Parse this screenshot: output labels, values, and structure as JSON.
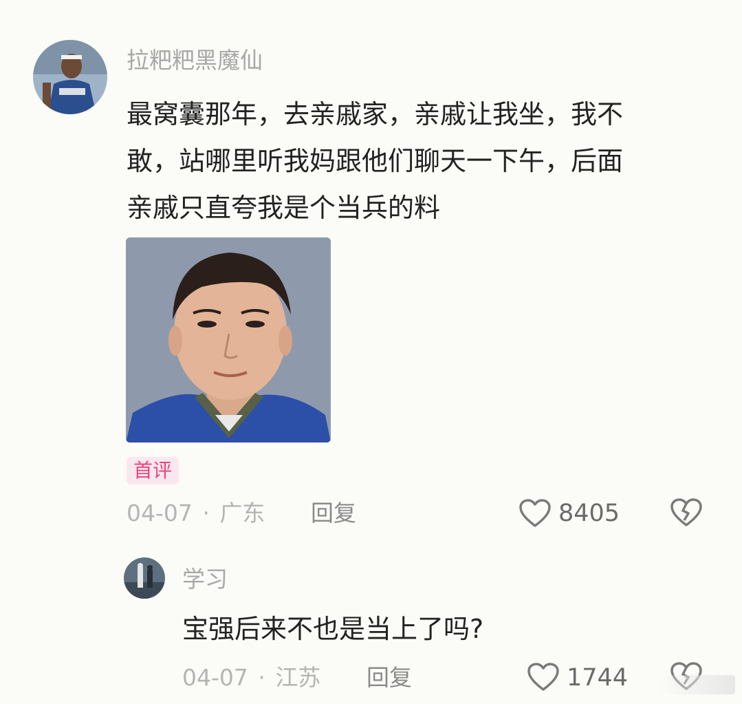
{
  "comment": {
    "username": "拉粑粑黑魔仙",
    "text_lines": [
      "最窝囊那年，去亲戚家，亲戚让我坐，我不",
      "敢，站哪里听我妈跟他们聊天一下午，后面",
      "亲戚只直夸我是个当兵的料"
    ],
    "badge": "首评",
    "date": "04-07",
    "separator": "·",
    "location": "广东",
    "reply_label": "回复",
    "like_count": "8405",
    "like_icon": "heart-outline-icon",
    "dislike_icon": "broken-heart-icon"
  },
  "reply": {
    "username": "学习",
    "text": "宝强后来不也是当上了吗?",
    "date": "04-07",
    "separator": "·",
    "location": "江苏",
    "reply_label": "回复",
    "like_count": "1744",
    "like_icon": "heart-outline-icon",
    "dislike_icon": "broken-heart-icon"
  },
  "colors": {
    "background": "#fbfbf7",
    "badge_bg": "#fbe8ef",
    "badge_text": "#e4467a",
    "username": "#a8a8a8",
    "text": "#222222"
  }
}
